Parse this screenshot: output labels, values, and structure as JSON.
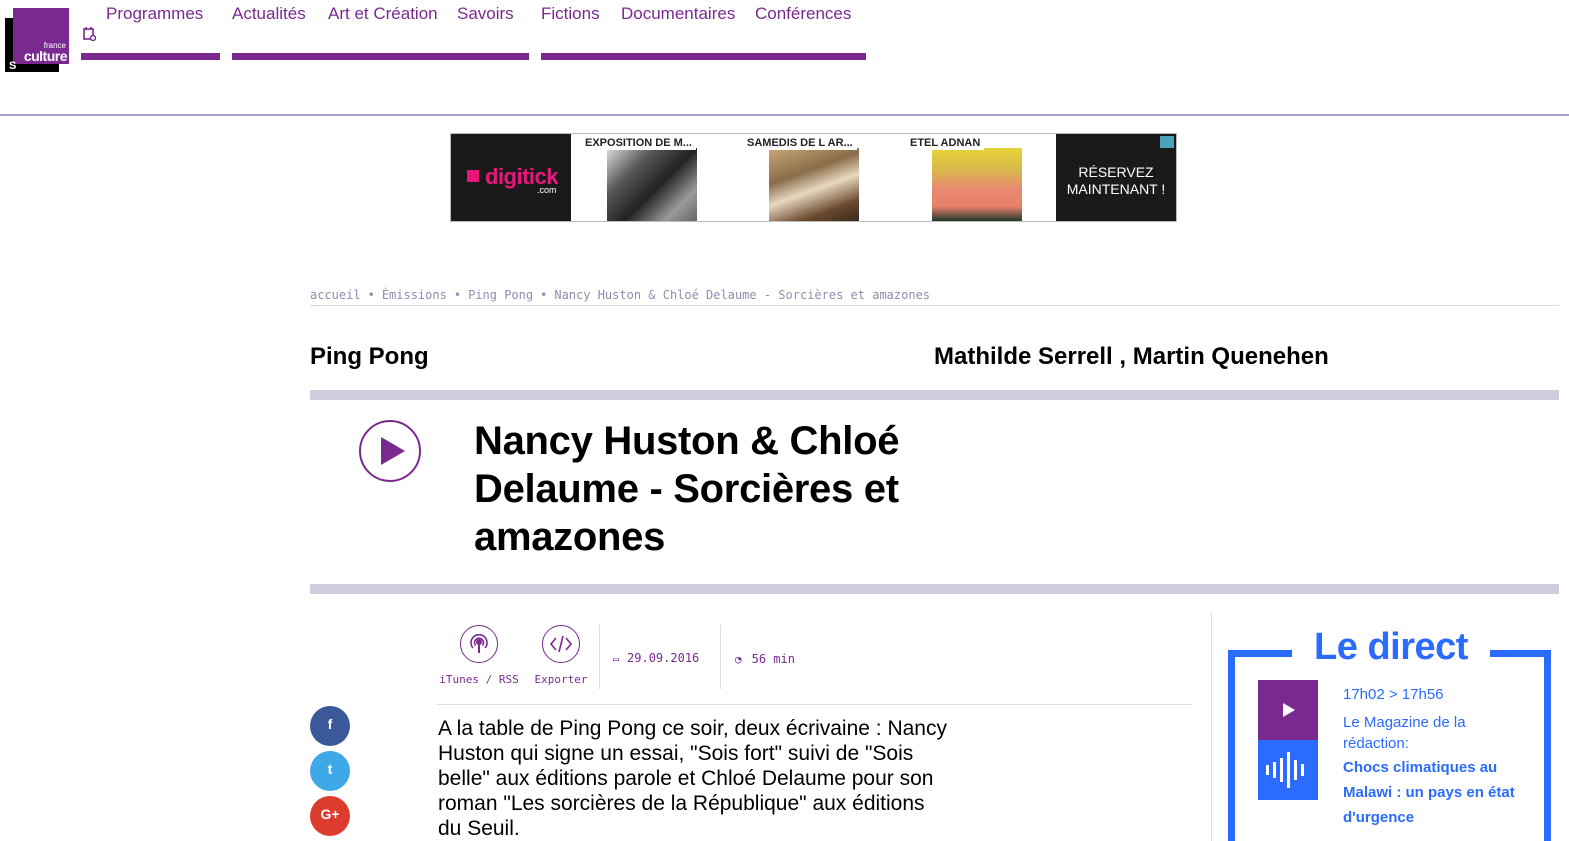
{
  "header": {
    "logo_small": "france",
    "logo_main": "culture",
    "nav": [
      "Programmes",
      "Actualités",
      "Art et Création",
      "Savoirs",
      "Fictions",
      "Documentaires",
      "Conférences"
    ]
  },
  "ad": {
    "brand": "digitick",
    "brand_domain": ".com",
    "cards": [
      "EXPOSITION DE M...",
      "SAMEDIS DE L AR...",
      "ETEL ADNAN"
    ],
    "cta": "RÉSERVEZ MAINTENANT !"
  },
  "breadcrumb": [
    "accueil",
    "Émissions",
    "Ping Pong",
    "Nancy Huston & Chloé Delaume - Sorcières et amazones"
  ],
  "breadcrumb_sep": "•",
  "show": {
    "title": "Ping Pong",
    "hosts": "Mathilde Serrell , Martin Quenehen"
  },
  "episode": {
    "title": "Nancy Huston & Chloé Delaume - Sorcières et amazones",
    "itunes_label": "iTunes / RSS",
    "export_label": "Exporter",
    "date": "29.09.2016",
    "duration": "56 min",
    "description": "A la table de Ping Pong ce soir, deux écrivaine : Nancy Huston qui signe un essai, \"Sois fort\" suivi de \"Sois belle\" aux éditions parole et Chloé Delaume pour son roman \"Les sorcières de la République\" aux éditions du Seuil."
  },
  "social": [
    "f",
    "t",
    "G+"
  ],
  "direct": {
    "title": "Le direct",
    "time": "17h02 > 17h56",
    "program": "Le Magazine de la rédaction:",
    "headline": "Chocs climatiques au Malawi : un pays en état d'urgence"
  },
  "colors": {
    "brand_purple": "#7a2a8f",
    "live_blue": "#2b6bff",
    "facebook": "#3b5998",
    "twitter": "#3fa8e6",
    "google": "#dd3b2d"
  }
}
